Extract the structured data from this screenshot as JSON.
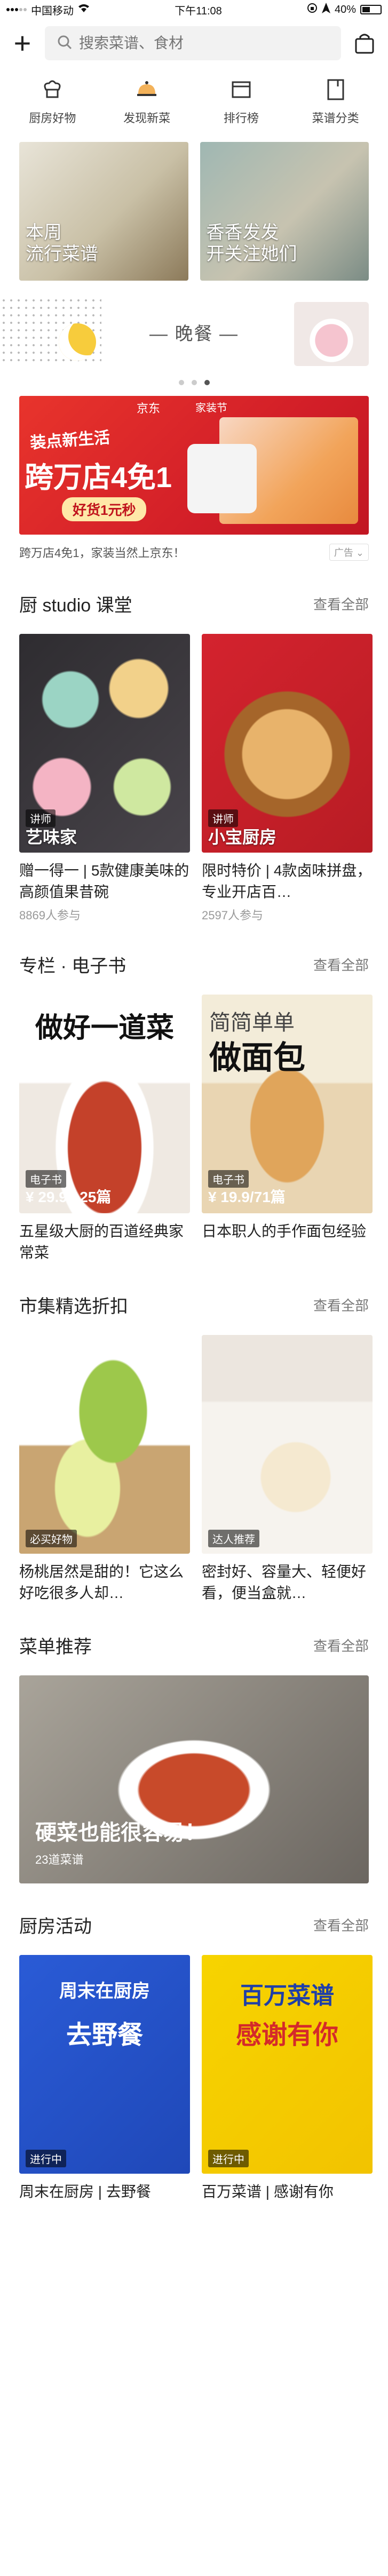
{
  "status": {
    "carrier": "中国移动",
    "time": "下午11:08",
    "battery": "40%"
  },
  "search": {
    "placeholder": "搜索菜谱、食材"
  },
  "quick_nav": [
    {
      "label": "厨房好物",
      "icon": "chef-hat-icon"
    },
    {
      "label": "发现新菜",
      "icon": "dish-cover-icon"
    },
    {
      "label": "排行榜",
      "icon": "ranking-icon"
    },
    {
      "label": "菜谱分类",
      "icon": "recipe-book-icon"
    }
  ],
  "feature_tiles": [
    {
      "line1": "本周",
      "line2": "流行菜谱"
    },
    {
      "line1": "香香发发",
      "line2": "开关注她们"
    }
  ],
  "meal": {
    "title": "— 晚餐 —"
  },
  "banner": {
    "brand": "京东",
    "fest": "家装节",
    "headline": "装点新生活",
    "big": "跨万店4免1",
    "button": "好货1元秒",
    "caption": "跨万店4免1，家装当然上京东！",
    "ad_tag": "广告"
  },
  "sections": {
    "studio": {
      "title": "厨 studio 课堂",
      "see_all": "查看全部",
      "items": [
        {
          "badge": "讲师",
          "overlay": "艺味家",
          "title": "赠一得一 | 5款健康美味的高颜值果昔碗",
          "sub": "8869人参与"
        },
        {
          "badge": "讲师",
          "overlay": "小宝厨房",
          "title": "限时特价 | 4款卤味拼盘，专业开店百…",
          "sub": "2597人参与"
        }
      ]
    },
    "ebook": {
      "title": "专栏 · 电子书",
      "see_all": "查看全部",
      "items": [
        {
          "heading": "做好一道菜",
          "badge": "电子书",
          "price": "¥ 29.9/125篇",
          "title": "五星级大厨的百道经典家常菜"
        },
        {
          "heading_top": "简简单单",
          "heading": "做面包",
          "badge": "电子书",
          "price": "¥ 19.9/71篇",
          "title": "日本职人的手作面包经验"
        }
      ]
    },
    "market": {
      "title": "市集精选折扣",
      "see_all": "查看全部",
      "items": [
        {
          "badge": "必买好物",
          "title": "杨桃居然是甜的！它这么好吃很多人却…"
        },
        {
          "badge": "达人推荐",
          "title": "密封好、容量大、轻便好看，便当盒就…"
        }
      ]
    },
    "menu": {
      "title": "菜单推荐",
      "see_all": "查看全部",
      "card": {
        "title": "硬菜也能很容易！",
        "sub": "23道菜谱"
      }
    },
    "events": {
      "title": "厨房活动",
      "see_all": "查看全部",
      "items": [
        {
          "poster_top": "周末在厨房",
          "poster_main": "去野餐",
          "badge": "进行中",
          "title": "周末在厨房 | 去野餐"
        },
        {
          "poster_top": "百万菜谱",
          "poster_main": "感谢有你",
          "badge": "进行中",
          "title": "百万菜谱 | 感谢有你"
        }
      ]
    }
  }
}
